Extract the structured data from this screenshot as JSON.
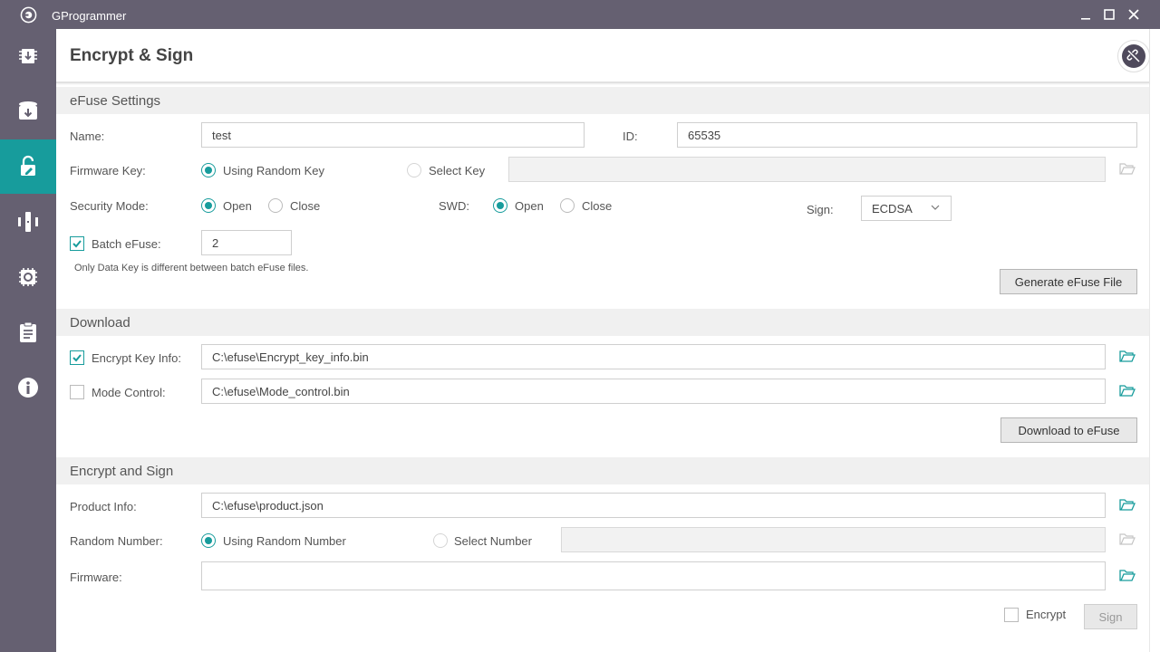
{
  "app": {
    "title": "GProgrammer"
  },
  "sidebar": {
    "items": [
      {
        "icon": "chip-download-icon",
        "active": false
      },
      {
        "icon": "database-download-icon",
        "active": false
      },
      {
        "icon": "lock-edit-icon",
        "active": true
      },
      {
        "icon": "tools-icon",
        "active": false
      },
      {
        "icon": "chip-settings-icon",
        "active": false
      },
      {
        "icon": "clipboard-icon",
        "active": false
      },
      {
        "icon": "info-icon",
        "active": false
      }
    ]
  },
  "header": {
    "title": "Encrypt & Sign"
  },
  "efuse": {
    "section_title": "eFuse Settings",
    "name_label": "Name:",
    "name_value": "test",
    "id_label": "ID:",
    "id_value": "65535",
    "fw_key_label": "Firmware Key:",
    "fw_key_random": "Using Random Key",
    "fw_key_select": "Select Key",
    "fw_key_path": "",
    "security_label": "Security Mode:",
    "security_open": "Open",
    "security_close": "Close",
    "swd_label": "SWD:",
    "swd_open": "Open",
    "swd_close": "Close",
    "sign_label": "Sign:",
    "sign_value": "ECDSA",
    "batch_label": "Batch eFuse:",
    "batch_checked": true,
    "batch_value": "2",
    "batch_hint": "Only Data Key is different between batch eFuse files.",
    "generate_button": "Generate eFuse File"
  },
  "download": {
    "section_title": "Download",
    "encrypt_key_label": "Encrypt Key Info:",
    "encrypt_key_checked": true,
    "encrypt_key_path": "C:\\efuse\\Encrypt_key_info.bin",
    "mode_control_label": "Mode Control:",
    "mode_control_checked": false,
    "mode_control_path": "C:\\efuse\\Mode_control.bin",
    "download_button": "Download to eFuse"
  },
  "encrypt_sign": {
    "section_title": "Encrypt and Sign",
    "product_label": "Product Info:",
    "product_path": "C:\\efuse\\product.json",
    "random_label": "Random Number:",
    "random_using": "Using Random Number",
    "random_select": "Select Number",
    "random_path": "",
    "firmware_label": "Firmware:",
    "firmware_path": "",
    "encrypt_label": "Encrypt",
    "encrypt_checked": false,
    "sign_button": "Sign"
  },
  "colors": {
    "accent": "#179c9c",
    "sidebar": "#656071",
    "section_bg": "#f0f0f0"
  }
}
